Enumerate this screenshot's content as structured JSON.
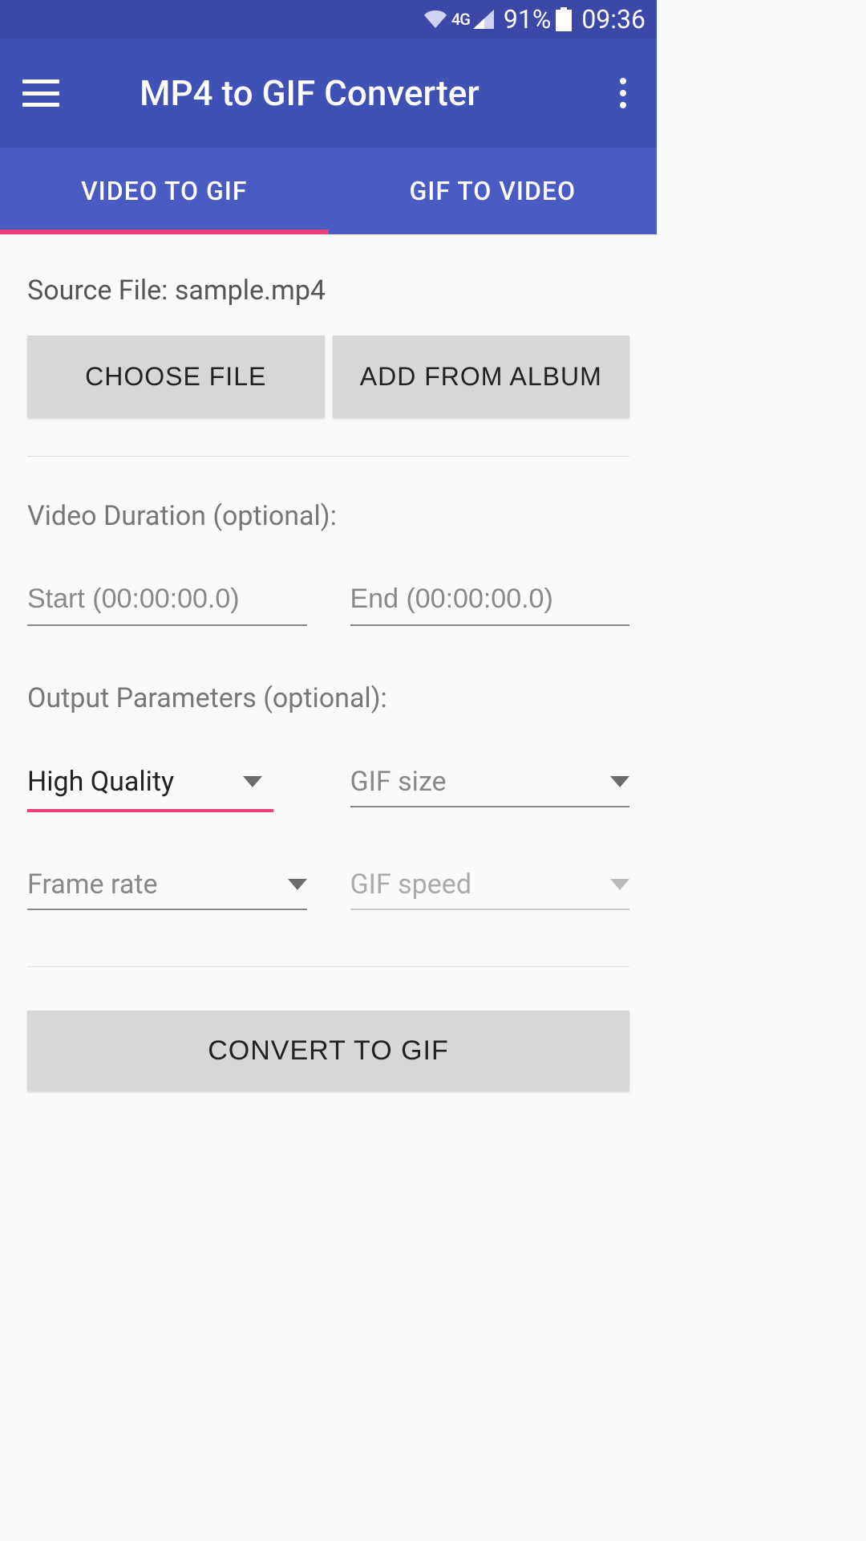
{
  "status": {
    "network": "4G",
    "battery_pct": "91%",
    "time": "09:36"
  },
  "header": {
    "title": "MP4 to GIF Converter"
  },
  "tabs": [
    "VIDEO TO GIF",
    "GIF TO VIDEO"
  ],
  "source": {
    "label_prefix": "Source File: ",
    "filename": "sample.mp4",
    "choose_label": "CHOOSE FILE",
    "album_label": "ADD FROM ALBUM"
  },
  "duration": {
    "section_label": "Video Duration (optional):",
    "start_placeholder": "Start (00:00:00.0)",
    "end_placeholder": "End (00:00:00.0)"
  },
  "output": {
    "section_label": "Output Parameters (optional):",
    "quality_value": "High Quality",
    "gif_size_placeholder": "GIF size",
    "frame_rate_placeholder": "Frame rate",
    "gif_speed_placeholder": "GIF speed"
  },
  "action": {
    "convert_label": "CONVERT TO GIF"
  }
}
